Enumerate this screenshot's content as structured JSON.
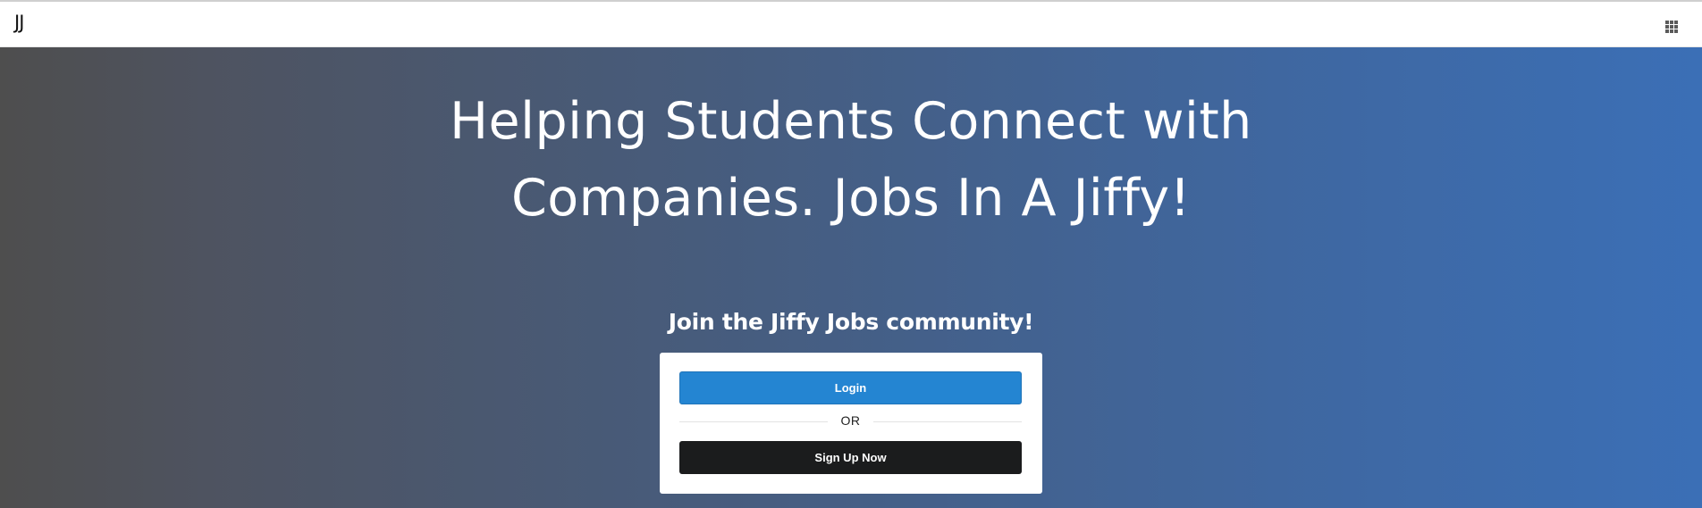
{
  "navbar": {
    "brand": "JJ",
    "apps_icon": "grid-icon"
  },
  "hero": {
    "headline_line1": "Helping Students Connect with",
    "headline_line2": "Companies. Jobs In A Jiffy!",
    "community_title": "Join the Jiffy Jobs community!"
  },
  "auth_card": {
    "login_label": "Login",
    "divider_label": "OR",
    "signup_label": "Sign Up Now"
  },
  "colors": {
    "login_button": "#2485d2",
    "signup_button": "#1b1c1d",
    "gradient_start": "#4e4e4e",
    "gradient_end": "#3b6fb6"
  }
}
